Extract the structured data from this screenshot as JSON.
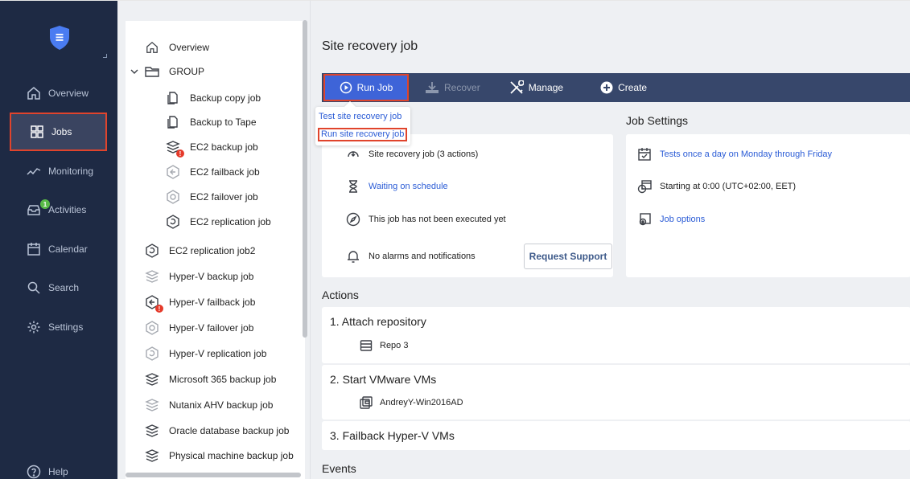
{
  "colors": {
    "nav_bg": "#1e2a44",
    "toolbar_bg": "#37476b",
    "primary_button": "#3e64d8",
    "highlight_border": "#e0442c",
    "link": "#2b5cd6",
    "success_badge": "#58b947",
    "error_badge": "#e53a2a"
  },
  "nav": {
    "logo_icon": "shield-icon",
    "items": [
      {
        "label": "Overview",
        "icon": "home-icon"
      },
      {
        "label": "Jobs",
        "icon": "grid-icon",
        "active": true
      },
      {
        "label": "Monitoring",
        "icon": "pulse-icon"
      },
      {
        "label": "Activities",
        "icon": "inbox-icon",
        "badge": "1"
      },
      {
        "label": "Calendar",
        "icon": "calendar-icon"
      },
      {
        "label": "Search",
        "icon": "search-icon"
      },
      {
        "label": "Settings",
        "icon": "gear-icon"
      }
    ],
    "help_label": "Help"
  },
  "tree": {
    "overview_label": "Overview",
    "group_label": "GROUP",
    "group_children": [
      {
        "label": "Backup copy job"
      },
      {
        "label": "Backup to Tape"
      },
      {
        "label": "EC2 backup job",
        "badge": "!"
      },
      {
        "label": "EC2 failback job"
      },
      {
        "label": "EC2 failover job"
      },
      {
        "label": "EC2 replication job"
      }
    ],
    "items": [
      {
        "label": "EC2 replication job2"
      },
      {
        "label": "Hyper-V backup job"
      },
      {
        "label": "Hyper-V failback job",
        "badge": "!"
      },
      {
        "label": "Hyper-V failover job"
      },
      {
        "label": "Hyper-V replication job"
      },
      {
        "label": "Microsoft 365 backup job"
      },
      {
        "label": "Nutanix AHV backup job"
      },
      {
        "label": "Oracle database backup job"
      },
      {
        "label": "Physical machine backup job"
      }
    ]
  },
  "main": {
    "title": "Site recovery job",
    "toolbar": {
      "run_label": "Run Job",
      "recover_label": "Recover",
      "manage_label": "Manage",
      "create_label": "Create"
    },
    "run_menu": {
      "items": [
        "Test site recovery job",
        "Run site recovery job"
      ]
    },
    "summary": {
      "job_info": "Site recovery job (3 actions)",
      "status": "Waiting on schedule",
      "last_run": "This job has not been executed yet",
      "alarms": "No alarms and notifications",
      "request_support_label": "Request Support"
    },
    "job_settings": {
      "heading": "Job Settings",
      "schedule": "Tests once a day on Monday through Friday",
      "start": "Starting at 0:00 (UTC+02:00, EET)",
      "options": "Job options"
    },
    "actions_heading": "Actions",
    "actions": [
      {
        "title": "1. Attach repository",
        "item": "Repo 3"
      },
      {
        "title": "2. Start VMware VMs",
        "item": "AndreyY-Win2016AD"
      },
      {
        "title": "3. Failback Hyper-V VMs"
      }
    ],
    "events_heading": "Events"
  }
}
